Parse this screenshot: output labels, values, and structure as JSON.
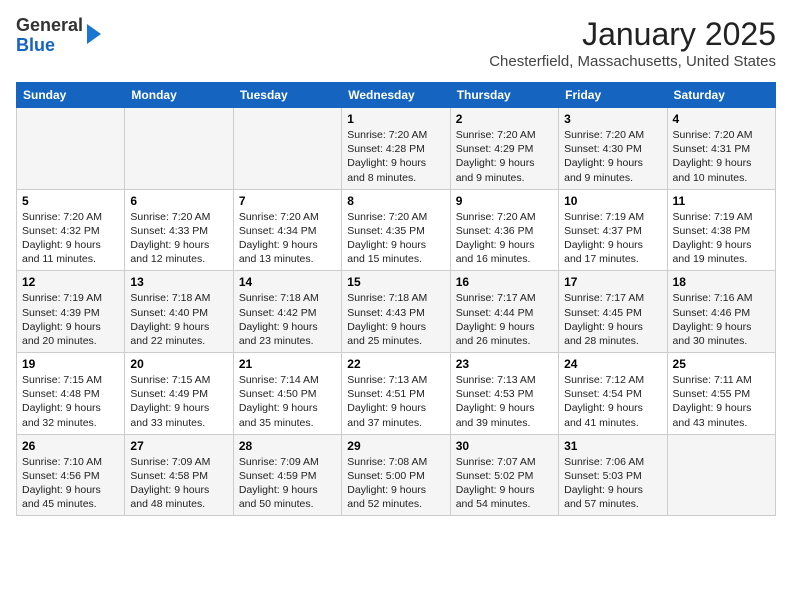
{
  "header": {
    "logo": {
      "general": "General",
      "blue": "Blue"
    },
    "title": "January 2025",
    "location": "Chesterfield, Massachusetts, United States"
  },
  "weekdays": [
    "Sunday",
    "Monday",
    "Tuesday",
    "Wednesday",
    "Thursday",
    "Friday",
    "Saturday"
  ],
  "rows": [
    [
      {
        "day": "",
        "info": ""
      },
      {
        "day": "",
        "info": ""
      },
      {
        "day": "",
        "info": ""
      },
      {
        "day": "1",
        "info": "Sunrise: 7:20 AM\nSunset: 4:28 PM\nDaylight: 9 hours\nand 8 minutes."
      },
      {
        "day": "2",
        "info": "Sunrise: 7:20 AM\nSunset: 4:29 PM\nDaylight: 9 hours\nand 9 minutes."
      },
      {
        "day": "3",
        "info": "Sunrise: 7:20 AM\nSunset: 4:30 PM\nDaylight: 9 hours\nand 9 minutes."
      },
      {
        "day": "4",
        "info": "Sunrise: 7:20 AM\nSunset: 4:31 PM\nDaylight: 9 hours\nand 10 minutes."
      }
    ],
    [
      {
        "day": "5",
        "info": "Sunrise: 7:20 AM\nSunset: 4:32 PM\nDaylight: 9 hours\nand 11 minutes."
      },
      {
        "day": "6",
        "info": "Sunrise: 7:20 AM\nSunset: 4:33 PM\nDaylight: 9 hours\nand 12 minutes."
      },
      {
        "day": "7",
        "info": "Sunrise: 7:20 AM\nSunset: 4:34 PM\nDaylight: 9 hours\nand 13 minutes."
      },
      {
        "day": "8",
        "info": "Sunrise: 7:20 AM\nSunset: 4:35 PM\nDaylight: 9 hours\nand 15 minutes."
      },
      {
        "day": "9",
        "info": "Sunrise: 7:20 AM\nSunset: 4:36 PM\nDaylight: 9 hours\nand 16 minutes."
      },
      {
        "day": "10",
        "info": "Sunrise: 7:19 AM\nSunset: 4:37 PM\nDaylight: 9 hours\nand 17 minutes."
      },
      {
        "day": "11",
        "info": "Sunrise: 7:19 AM\nSunset: 4:38 PM\nDaylight: 9 hours\nand 19 minutes."
      }
    ],
    [
      {
        "day": "12",
        "info": "Sunrise: 7:19 AM\nSunset: 4:39 PM\nDaylight: 9 hours\nand 20 minutes."
      },
      {
        "day": "13",
        "info": "Sunrise: 7:18 AM\nSunset: 4:40 PM\nDaylight: 9 hours\nand 22 minutes."
      },
      {
        "day": "14",
        "info": "Sunrise: 7:18 AM\nSunset: 4:42 PM\nDaylight: 9 hours\nand 23 minutes."
      },
      {
        "day": "15",
        "info": "Sunrise: 7:18 AM\nSunset: 4:43 PM\nDaylight: 9 hours\nand 25 minutes."
      },
      {
        "day": "16",
        "info": "Sunrise: 7:17 AM\nSunset: 4:44 PM\nDaylight: 9 hours\nand 26 minutes."
      },
      {
        "day": "17",
        "info": "Sunrise: 7:17 AM\nSunset: 4:45 PM\nDaylight: 9 hours\nand 28 minutes."
      },
      {
        "day": "18",
        "info": "Sunrise: 7:16 AM\nSunset: 4:46 PM\nDaylight: 9 hours\nand 30 minutes."
      }
    ],
    [
      {
        "day": "19",
        "info": "Sunrise: 7:15 AM\nSunset: 4:48 PM\nDaylight: 9 hours\nand 32 minutes."
      },
      {
        "day": "20",
        "info": "Sunrise: 7:15 AM\nSunset: 4:49 PM\nDaylight: 9 hours\nand 33 minutes."
      },
      {
        "day": "21",
        "info": "Sunrise: 7:14 AM\nSunset: 4:50 PM\nDaylight: 9 hours\nand 35 minutes."
      },
      {
        "day": "22",
        "info": "Sunrise: 7:13 AM\nSunset: 4:51 PM\nDaylight: 9 hours\nand 37 minutes."
      },
      {
        "day": "23",
        "info": "Sunrise: 7:13 AM\nSunset: 4:53 PM\nDaylight: 9 hours\nand 39 minutes."
      },
      {
        "day": "24",
        "info": "Sunrise: 7:12 AM\nSunset: 4:54 PM\nDaylight: 9 hours\nand 41 minutes."
      },
      {
        "day": "25",
        "info": "Sunrise: 7:11 AM\nSunset: 4:55 PM\nDaylight: 9 hours\nand 43 minutes."
      }
    ],
    [
      {
        "day": "26",
        "info": "Sunrise: 7:10 AM\nSunset: 4:56 PM\nDaylight: 9 hours\nand 45 minutes."
      },
      {
        "day": "27",
        "info": "Sunrise: 7:09 AM\nSunset: 4:58 PM\nDaylight: 9 hours\nand 48 minutes."
      },
      {
        "day": "28",
        "info": "Sunrise: 7:09 AM\nSunset: 4:59 PM\nDaylight: 9 hours\nand 50 minutes."
      },
      {
        "day": "29",
        "info": "Sunrise: 7:08 AM\nSunset: 5:00 PM\nDaylight: 9 hours\nand 52 minutes."
      },
      {
        "day": "30",
        "info": "Sunrise: 7:07 AM\nSunset: 5:02 PM\nDaylight: 9 hours\nand 54 minutes."
      },
      {
        "day": "31",
        "info": "Sunrise: 7:06 AM\nSunset: 5:03 PM\nDaylight: 9 hours\nand 57 minutes."
      },
      {
        "day": "",
        "info": ""
      }
    ]
  ]
}
